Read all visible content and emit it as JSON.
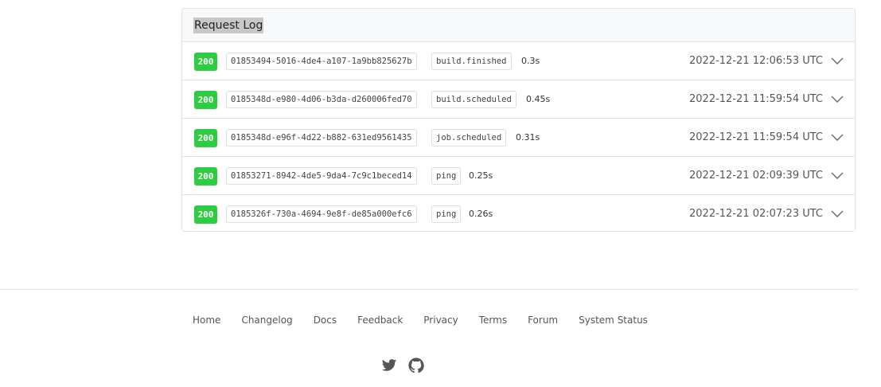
{
  "request_log": {
    "title": "Request Log",
    "rows": [
      {
        "status": "200",
        "id": "01853494-5016-4de4-a107-1a9bb825627b",
        "event": "build.finished",
        "duration": "0.3s",
        "timestamp": "2022-12-21 12:06:53 UTC"
      },
      {
        "status": "200",
        "id": "0185348d-e980-4d06-b3da-d260006fed70",
        "event": "build.scheduled",
        "duration": "0.45s",
        "timestamp": "2022-12-21 11:59:54 UTC"
      },
      {
        "status": "200",
        "id": "0185348d-e96f-4d22-b882-631ed9561435",
        "event": "job.scheduled",
        "duration": "0.31s",
        "timestamp": "2022-12-21 11:59:54 UTC"
      },
      {
        "status": "200",
        "id": "01853271-8942-4de5-9da4-7c9c1beced14",
        "event": "ping",
        "duration": "0.25s",
        "timestamp": "2022-12-21 02:09:39 UTC"
      },
      {
        "status": "200",
        "id": "0185326f-730a-4694-9e8f-de85a000efc6",
        "event": "ping",
        "duration": "0.26s",
        "timestamp": "2022-12-21 02:07:23 UTC"
      }
    ]
  },
  "footer": {
    "links": [
      "Home",
      "Changelog",
      "Docs",
      "Feedback",
      "Privacy",
      "Terms",
      "Forum",
      "System Status"
    ],
    "social_icons": [
      "twitter-icon",
      "github-icon"
    ]
  },
  "colors": {
    "status_ok": "#2ecc40",
    "header_bg": "#f8f9fa",
    "border": "#e1e4e8"
  }
}
